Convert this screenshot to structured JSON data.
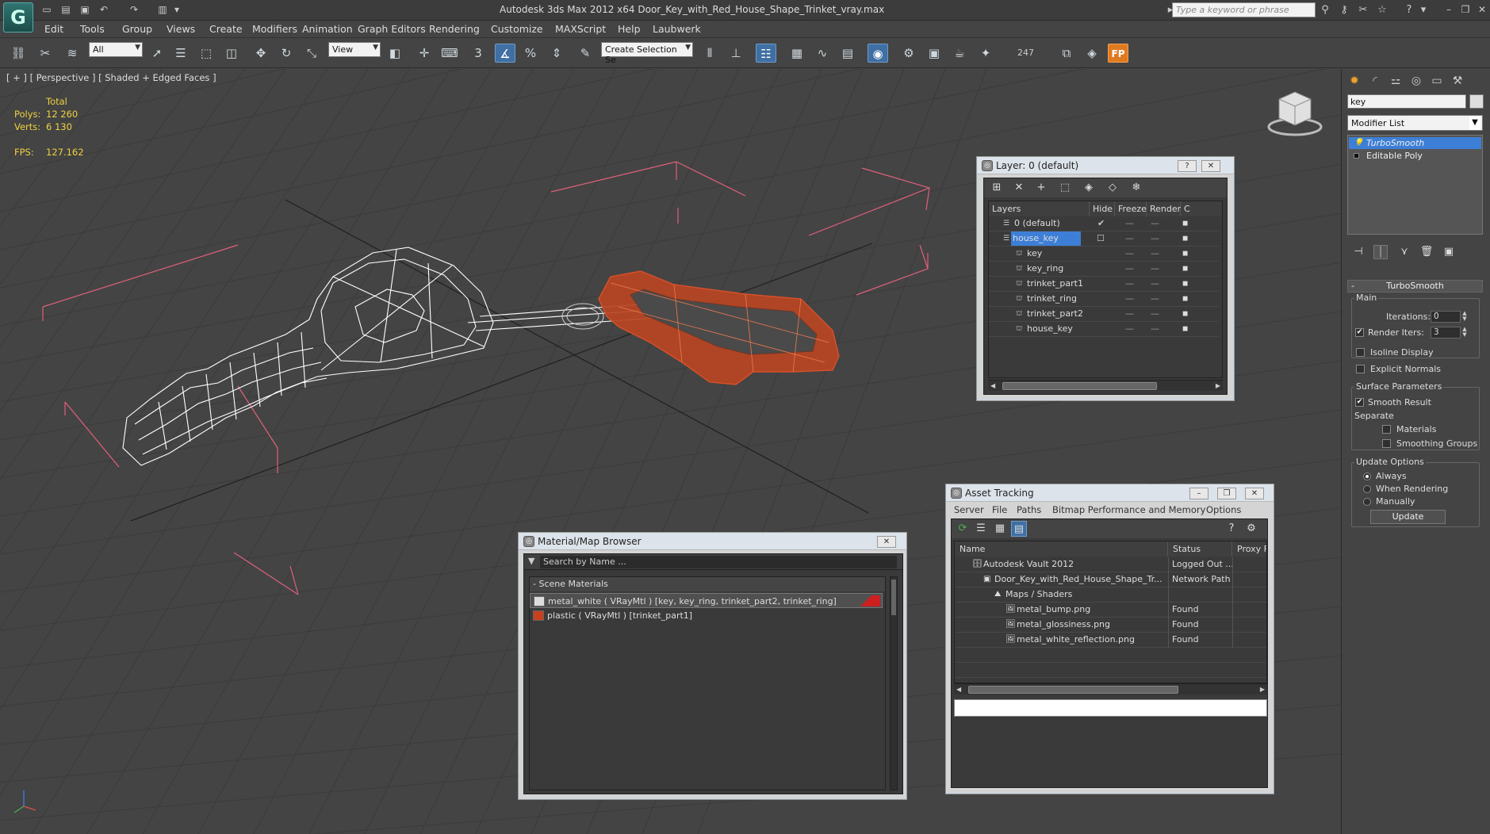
{
  "app": {
    "title": "Autodesk 3ds Max  2012 x64      Door_Key_with_Red_House_Shape_Trinket_vray.max",
    "logo_text": "G",
    "search_placeholder": "Type a keyword or phrase"
  },
  "menu": [
    "Edit",
    "Tools",
    "Group",
    "Views",
    "Create",
    "Modifiers",
    "Animation",
    "Graph Editors",
    "Rendering",
    "Customize",
    "MAXScript",
    "Help",
    "Laubwerk"
  ],
  "toolbar": {
    "filter_value": "All",
    "refcoord_value": "View",
    "selection_set_placeholder": "Create Selection Se",
    "snap_label": "3",
    "count_label": "247"
  },
  "viewport": {
    "label": "[ + ] [ Perspective ] [ Shaded + Edged Faces ]",
    "stats": {
      "header": "Total",
      "polys_label": "Polys:",
      "polys_value": "12 260",
      "verts_label": "Verts:",
      "verts_value": "6 130",
      "fps_label": "FPS:",
      "fps_value": "127.162"
    },
    "colors": {
      "bg": "#444444",
      "grid": "#3a3a3a",
      "bbox": "#e0607a",
      "wire_key": "#ffffff",
      "trinket": "#d9502a"
    }
  },
  "command_panel": {
    "object_name": "key",
    "modifier_list_label": "Modifier List",
    "stack": [
      "TurboSmooth",
      "Editable Poly"
    ],
    "rollout_title": "TurboSmooth",
    "main_label": "Main",
    "iterations_label": "Iterations:",
    "iterations_value": "0",
    "render_iters_label": "Render Iters:",
    "render_iters_value": "3",
    "isoline_label": "Isoline Display",
    "explicit_normals_label": "Explicit Normals",
    "surface_params_label": "Surface Parameters",
    "smooth_result_label": "Smooth Result",
    "separate_label": "Separate",
    "materials_label": "Materials",
    "smoothing_groups_label": "Smoothing Groups",
    "update_options_label": "Update Options",
    "always_label": "Always",
    "when_rendering_label": "When Rendering",
    "manually_label": "Manually",
    "update_button": "Update"
  },
  "layer_dialog": {
    "title": "Layer: 0 (default)",
    "help_btn": "?",
    "close_btn": "✕",
    "headers": [
      "Layers",
      "Hide",
      "Freeze",
      "Render",
      "C"
    ],
    "rows": [
      {
        "name": "0 (default)",
        "indent": 0,
        "selected": false,
        "active": true
      },
      {
        "name": "house_key",
        "indent": 0,
        "selected": true,
        "active": false
      },
      {
        "name": "key",
        "indent": 1,
        "selected": false,
        "active": false
      },
      {
        "name": "key_ring",
        "indent": 1,
        "selected": false,
        "active": false
      },
      {
        "name": "trinket_part1",
        "indent": 1,
        "selected": false,
        "active": false
      },
      {
        "name": "trinket_ring",
        "indent": 1,
        "selected": false,
        "active": false
      },
      {
        "name": "trinket_part2",
        "indent": 1,
        "selected": false,
        "active": false
      },
      {
        "name": "house_key",
        "indent": 1,
        "selected": false,
        "active": false
      }
    ]
  },
  "material_browser": {
    "title": "Material/Map Browser",
    "close_btn": "✕",
    "search_placeholder": "Search by Name ...",
    "group_label": "- Scene Materials",
    "items": [
      {
        "label": "metal_white  ( VRayMtl )  [key, key_ring, trinket_part2, trinket_ring]",
        "swatch": "#dddddd",
        "selected": true
      },
      {
        "label": "plastic  ( VRayMtl )  [trinket_part1]",
        "swatch": "#c8401e",
        "selected": false
      }
    ]
  },
  "asset_tracking": {
    "title": "Asset Tracking",
    "menu": [
      "Server",
      "File",
      "Paths",
      "Bitmap Performance and Memory",
      "Options"
    ],
    "headers": [
      "Name",
      "Status",
      "Proxy F"
    ],
    "rows": [
      {
        "name": "Autodesk Vault 2012",
        "status": "Logged Out ...",
        "indent": 1
      },
      {
        "name": "Door_Key_with_Red_House_Shape_Tr...",
        "status": "Network Path",
        "indent": 2
      },
      {
        "name": "Maps / Shaders",
        "status": "",
        "indent": 3
      },
      {
        "name": "metal_bump.png",
        "status": "Found",
        "indent": 4
      },
      {
        "name": "metal_glossiness.png",
        "status": "Found",
        "indent": 4
      },
      {
        "name": "metal_white_reflection.png",
        "status": "Found",
        "indent": 4
      }
    ]
  }
}
